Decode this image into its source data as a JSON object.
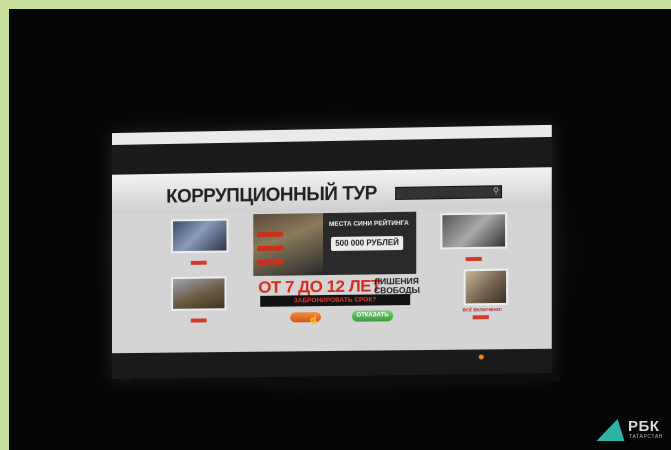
{
  "site": {
    "title": "КОРРУПЦИОННЫЙ ТУР",
    "slider_heading": "МЕСТА СИНИ РЕЙТИНГА",
    "price": "500 000 РУБЛЕЙ",
    "offer_main": "ОТ 7 ДО 12 ЛЕТ",
    "offer_sub_1": "ЛИШЕНИЯ",
    "offer_sub_2": "СВОБОДЫ",
    "reserve": "ЗАБРОНИРОВАТЬ СРОК?",
    "refuse_button": "ОТКАЗАТЬ",
    "right_caption": "ВСЁ ВКЛЮЧЕНО!"
  },
  "logo": {
    "text": "РБК",
    "subtext": "ТАТАРСТАН"
  },
  "colors": {
    "accent_red": "#d72b1f",
    "logo_teal": "#2bb3a5",
    "button_green": "#3c9a3c",
    "button_orange": "#d0561a"
  }
}
